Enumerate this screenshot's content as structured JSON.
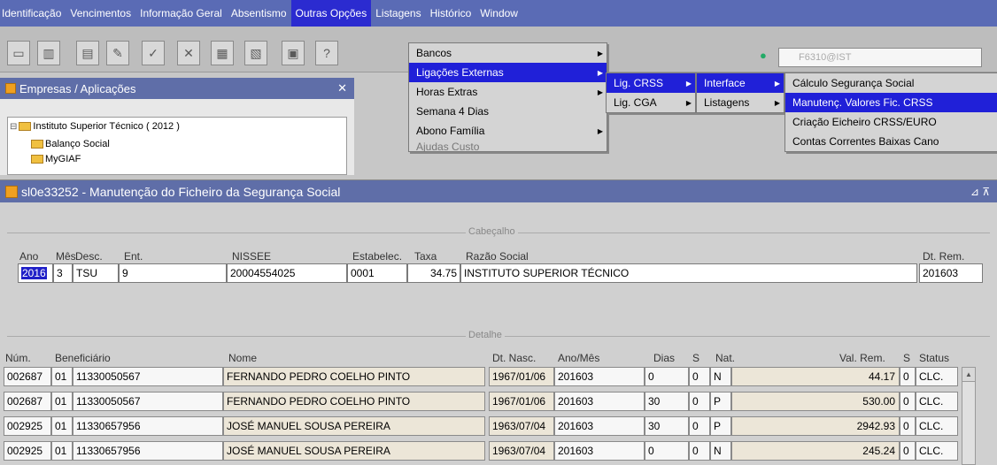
{
  "menubar": {
    "items": [
      "Identificação",
      "Vencimentos",
      "Informação Geral",
      "Absentismo",
      "Outras Opções",
      "Listagens",
      "Histórico",
      "Window"
    ]
  },
  "toolbar": {
    "user_field": "F6310@IST"
  },
  "left_panel": {
    "title": "Empresas / Aplicações",
    "tree": [
      "Instituto Superior Técnico ( 2012 )",
      "Balanço Social",
      "MyGIAF"
    ]
  },
  "menus": {
    "outras_opcoes": [
      "Bancos",
      "Ligações Externas",
      "Horas Extras",
      "Semana 4 Dias",
      "Abono Família",
      "Ajudas Custo"
    ],
    "ligacoes_externas": [
      "Lig. CRSS",
      "Lig. CGA"
    ],
    "lig_crss": [
      "Interface",
      "Listagens"
    ],
    "interface": [
      "Cálculo Segurança Social",
      "Manutenç. Valores Fic. CRSS",
      "Criação Eicheiro CRSS/EURO",
      "Contas Correntes Baixas Cano"
    ]
  },
  "window": {
    "title": "sl0e33252 - Manutenção do Ficheiro da Segurança Social"
  },
  "header": {
    "section": "Cabeçalho",
    "labels": {
      "ano": "Ano",
      "mes": "Mês",
      "desc": "Desc.",
      "ent": "Ent.",
      "nissee": "NISSEE",
      "estabelec": "Estabelec.",
      "taxa": "Taxa",
      "razao": "Razão Social",
      "dt_rem": "Dt. Rem."
    },
    "values": {
      "ano": "2016",
      "mes": "3",
      "desc": "TSU",
      "ent": "9",
      "nissee": "20004554025",
      "estabelec": "0001",
      "taxa": "34.75",
      "razao": "INSTITUTO SUPERIOR TÉCNICO",
      "dt_rem": "201603"
    }
  },
  "detail": {
    "section": "Detalhe",
    "columns": [
      "Núm.",
      "Beneficiário",
      "Nome",
      "Dt. Nasc.",
      "Ano/Mês",
      "Dias",
      "S",
      "Nat.",
      "Val. Rem.",
      "S",
      "Status"
    ],
    "rows": [
      [
        "002687",
        "01",
        "11330050567",
        "FERNANDO PEDRO COELHO PINTO",
        "1967/01/06",
        "201603",
        "0",
        "0",
        "N",
        "44.17",
        "0",
        "CLC."
      ],
      [
        "002687",
        "01",
        "11330050567",
        "FERNANDO PEDRO COELHO PINTO",
        "1967/01/06",
        "201603",
        "30",
        "0",
        "P",
        "530.00",
        "0",
        "CLC."
      ],
      [
        "002925",
        "01",
        "11330657956",
        "JOSÉ MANUEL SOUSA PEREIRA",
        "1963/07/04",
        "201603",
        "30",
        "0",
        "P",
        "2942.93",
        "0",
        "CLC."
      ],
      [
        "002925",
        "01",
        "11330657956",
        "JOSÉ MANUEL SOUSA PEREIRA",
        "1963/07/04",
        "201603",
        "0",
        "0",
        "N",
        "245.24",
        "0",
        "CLC."
      ]
    ]
  }
}
